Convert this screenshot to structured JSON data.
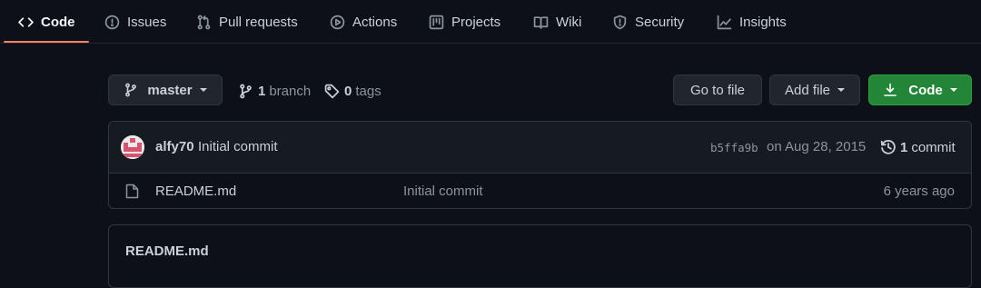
{
  "nav": {
    "tabs": [
      {
        "label": "Code",
        "icon": "code-icon",
        "active": true
      },
      {
        "label": "Issues",
        "icon": "issue-icon"
      },
      {
        "label": "Pull requests",
        "icon": "pull-request-icon"
      },
      {
        "label": "Actions",
        "icon": "play-icon"
      },
      {
        "label": "Projects",
        "icon": "project-icon"
      },
      {
        "label": "Wiki",
        "icon": "book-icon"
      },
      {
        "label": "Security",
        "icon": "shield-icon"
      },
      {
        "label": "Insights",
        "icon": "graph-icon"
      }
    ],
    "active_color": "#f78166"
  },
  "toolbar": {
    "branch_selector": "master",
    "branch_count": "1",
    "branch_label": "branch",
    "tag_count": "0",
    "tag_label": "tags",
    "go_to_file": "Go to file",
    "add_file": "Add file",
    "code_button": "Code",
    "code_button_color": "#238636"
  },
  "latest_commit": {
    "author": "alfy70",
    "message": "Initial commit",
    "sha": "b5ffa9b",
    "date": "on Aug 28, 2015",
    "commit_count": "1",
    "commit_label": "commit"
  },
  "files": [
    {
      "name": "README.md",
      "icon": "file-icon",
      "commit_message": "Initial commit",
      "age": "6 years ago"
    }
  ],
  "readme": {
    "title": "README.md"
  },
  "theme": {
    "background": "#0d1117",
    "border": "#30363d",
    "muted_text": "#8b949e"
  }
}
